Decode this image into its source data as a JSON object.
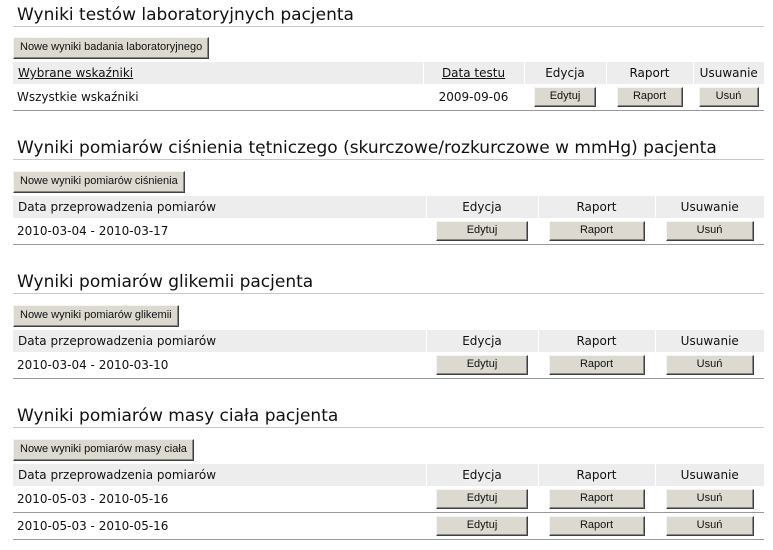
{
  "lab": {
    "title": "Wyniki testów laboratoryjnych pacjenta",
    "new_button": "Nowe wyniki badania laboratoryjnego",
    "headers": {
      "indicators": "Wybrane wskaźniki",
      "date": "Data testu",
      "edit": "Edycja",
      "report": "Raport",
      "delete": "Usuwanie"
    },
    "rows": [
      {
        "indicators": "Wszystkie wskaźniki",
        "date": "2009-09-06",
        "edit": "Edytuj",
        "report": "Raport",
        "delete": "Usuń"
      }
    ]
  },
  "pressure": {
    "title": "Wyniki pomiarów ciśnienia tętniczego (skurczowe/rozkurczowe w mmHg) pacjenta",
    "new_button": "Nowe wyniki pomiarów ciśnienia",
    "headers": {
      "date": "Data przeprowadzenia pomiarów",
      "edit": "Edycja",
      "report": "Raport",
      "delete": "Usuwanie"
    },
    "rows": [
      {
        "date": "2010-03-04 - 2010-03-17",
        "edit": "Edytuj",
        "report": "Raport",
        "delete": "Usuń"
      }
    ]
  },
  "glycemia": {
    "title": "Wyniki pomiarów glikemii pacjenta",
    "new_button": "Nowe wyniki pomiarów glikemii",
    "headers": {
      "date": "Data przeprowadzenia pomiarów",
      "edit": "Edycja",
      "report": "Raport",
      "delete": "Usuwanie"
    },
    "rows": [
      {
        "date": "2010-03-04 - 2010-03-10",
        "edit": "Edytuj",
        "report": "Raport",
        "delete": "Usuń"
      }
    ]
  },
  "weight": {
    "title": "Wyniki pomiarów masy ciała pacjenta",
    "new_button": "Nowe wyniki pomiarów masy ciała",
    "headers": {
      "date": "Data przeprowadzenia pomiarów",
      "edit": "Edycja",
      "report": "Raport",
      "delete": "Usuwanie"
    },
    "rows": [
      {
        "date": "2010-05-03 - 2010-05-16",
        "edit": "Edytuj",
        "report": "Raport",
        "delete": "Usuń"
      },
      {
        "date": "2010-05-03 - 2010-05-16",
        "edit": "Edytuj",
        "report": "Raport",
        "delete": "Usuń"
      }
    ]
  }
}
